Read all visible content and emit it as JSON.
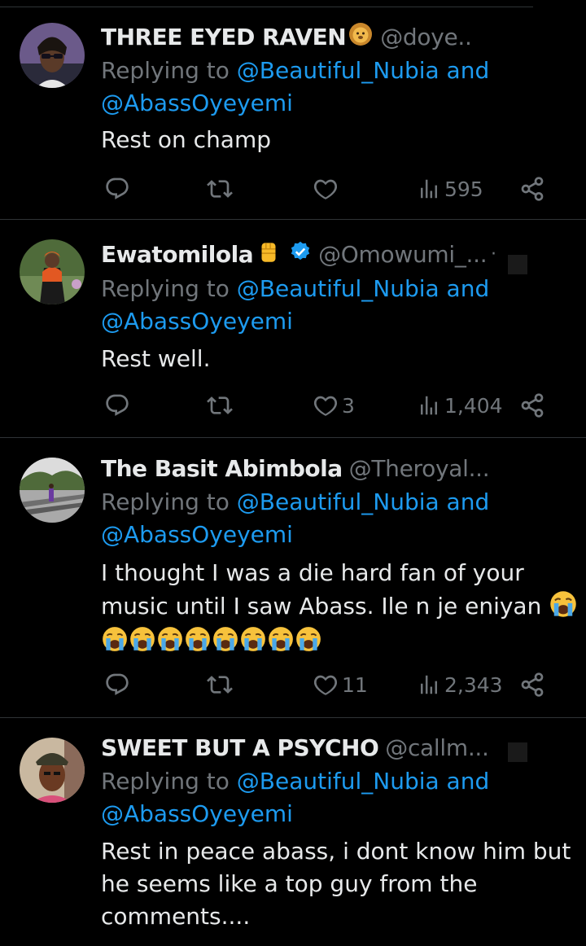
{
  "replying_prefix": "Replying to ",
  "replying_and": " and",
  "tweets": [
    {
      "name": "THREE EYED RAVEN",
      "name_emoji": "lion-face-emoji",
      "handle": "@doye..",
      "mention1": "@Beautiful_Nubia",
      "mention2": "@AbassOyeyemi",
      "text": "Rest on champ",
      "likes": "",
      "views": "595"
    },
    {
      "name": "Ewatomilola",
      "name_emoji": "raised-fist-emoji",
      "verified": true,
      "handle": "@Omowumi_...",
      "more": "·",
      "mention1": "@Beautiful_Nubia",
      "mention2": "@AbassOyeyemi",
      "text": "Rest well.",
      "likes": "3",
      "views": "1,404"
    },
    {
      "name": "The Basit Abimbola",
      "handle": "@Theroyal...",
      "mention1": "@Beautiful_Nubia",
      "mention2": "@AbassOyeyemi",
      "text_line1": "I thought I was a die hard fan of your",
      "text_line2": "music until I saw Abass. Ile n je eniyan",
      "crying_emoji_count": 8,
      "likes": "11",
      "views": "2,343"
    },
    {
      "name": "SWEET BUT A PSYCHO",
      "handle": "@callm...",
      "mention1": "@Beautiful_Nubia",
      "mention2": "@AbassOyeyemi",
      "text_line1": "Rest in peace abass, i dont know him but",
      "text_line2": "he seems like a top guy from the",
      "text_line3": "comments...."
    }
  ],
  "colors": {
    "background": "#000000",
    "text": "#e7e9ea",
    "muted": "#71767b",
    "link": "#1d9bf0",
    "divider": "#2f3336"
  }
}
